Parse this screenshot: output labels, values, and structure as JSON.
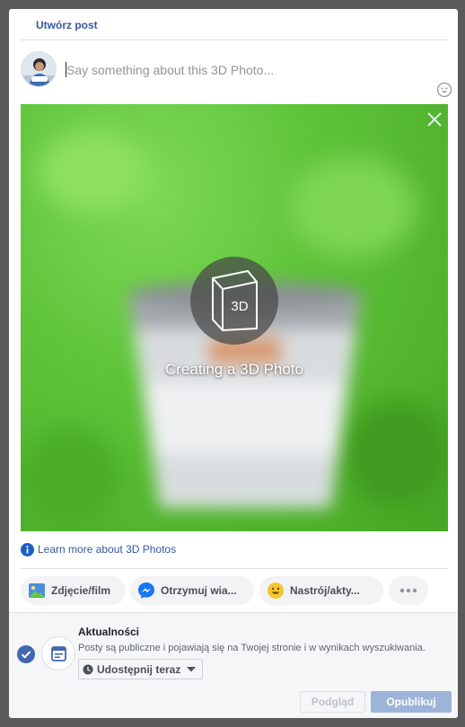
{
  "dialog": {
    "title": "Utwórz post",
    "composer": {
      "placeholder": "Say something about this 3D Photo..."
    },
    "photo": {
      "badge_label": "3D",
      "status_text": "Creating a 3D Photo"
    },
    "learn_more_label": "Learn more about 3D Photos",
    "actions": [
      {
        "label": "Zdjęcie/film",
        "icon": "photo-video-icon"
      },
      {
        "label": "Otrzymuj wia...",
        "icon": "messenger-icon"
      },
      {
        "label": "Nastrój/akty...",
        "icon": "emoji-icon"
      },
      {
        "label": "",
        "icon": "more-icon"
      }
    ],
    "footer": {
      "feed_title": "Aktualności",
      "feed_description": "Posty są publiczne i pojawiają się na Twojej stronie i w wynikach wyszukiwania.",
      "share_label": "Udostępnij teraz",
      "preview_label": "Podgląd",
      "publish_label": "Opublikuj"
    }
  },
  "colors": {
    "link_blue": "#365899",
    "primary_blue": "#4267b2",
    "publish_disabled": "#9cb4d8",
    "grass_green": "#5fc43a"
  }
}
